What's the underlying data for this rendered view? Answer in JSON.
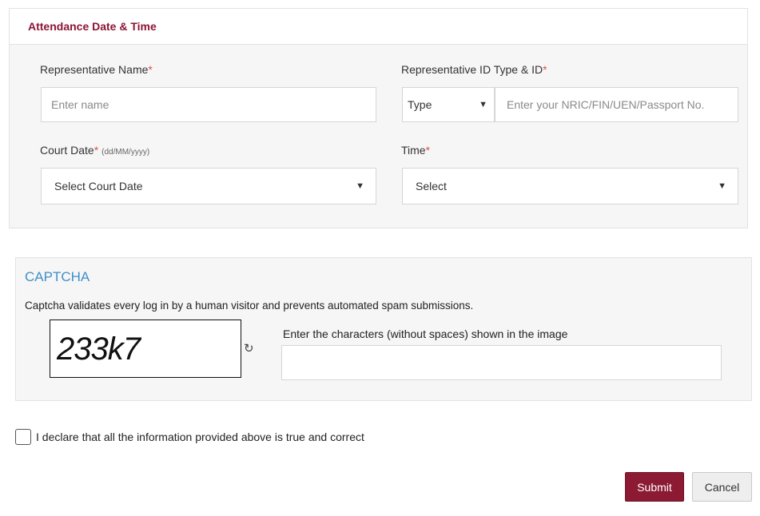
{
  "attendance": {
    "title": "Attendance Date & Time",
    "rep_name_label": "Representative Name",
    "rep_name_placeholder": "Enter name",
    "rep_id_label": "Representative ID Type & ID",
    "id_type_value": "Type",
    "id_placeholder": "Enter your NRIC/FIN/UEN/Passport No.",
    "court_date_label": "Court Date",
    "court_date_hint": "(dd/MM/yyyy)",
    "court_date_value": "Select Court Date",
    "time_label": "Time",
    "time_value": "Select",
    "required_mark": "*"
  },
  "captcha": {
    "title": "CAPTCHA",
    "description": "Captcha validates every log in by a human visitor and prevents automated spam submissions.",
    "image_text": "233k7",
    "input_label": "Enter the characters (without spaces) shown in the image",
    "input_value": ""
  },
  "declaration": {
    "text": "I declare that all the information provided above is true and correct",
    "checked": false
  },
  "actions": {
    "submit_label": "Submit",
    "cancel_label": "Cancel"
  },
  "icons": {
    "dropdown": "▼",
    "refresh": "↻"
  },
  "colors": {
    "brand": "#8b1533",
    "captcha_title": "#3f8fc8",
    "required": "#d9534f"
  }
}
